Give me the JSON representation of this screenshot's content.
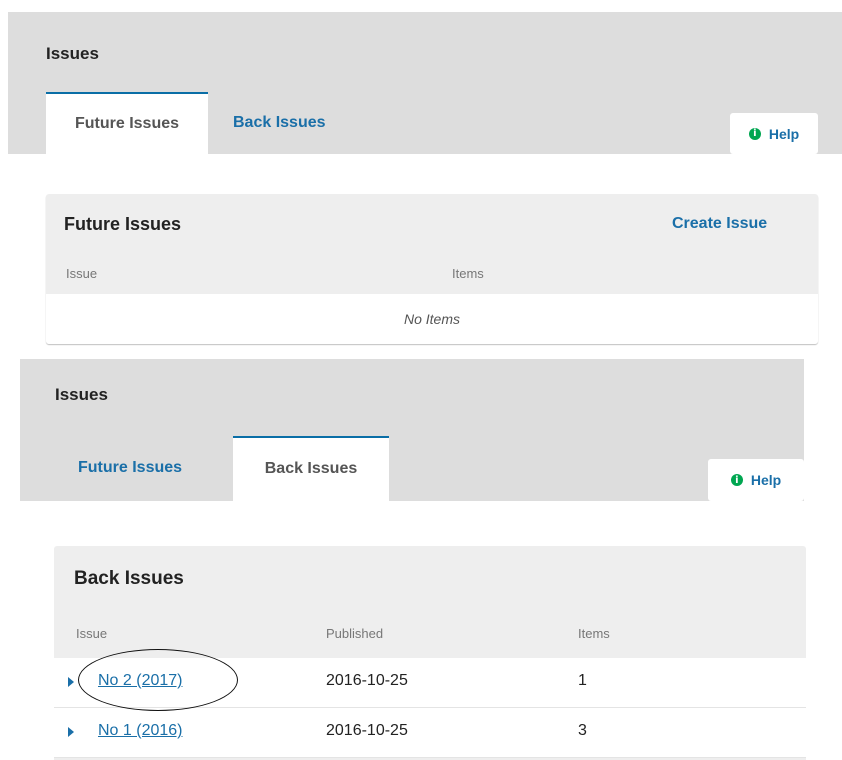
{
  "top_panel": {
    "title": "Issues",
    "tabs": [
      {
        "label": "Future Issues",
        "active": true
      },
      {
        "label": "Back Issues",
        "active": false
      }
    ],
    "help": {
      "icon": "info-circle-icon",
      "label": "Help"
    },
    "grid": {
      "title": "Future Issues",
      "action": "Create Issue",
      "columns": [
        "Issue",
        "Items"
      ],
      "empty_text": "No Items"
    }
  },
  "bottom_panel": {
    "title": "Issues",
    "tabs": [
      {
        "label": "Future Issues",
        "active": false
      },
      {
        "label": "Back Issues",
        "active": true
      }
    ],
    "help": {
      "icon": "info-circle-icon",
      "label": "Help"
    },
    "grid": {
      "title": "Back Issues",
      "columns": [
        "Issue",
        "Published",
        "Items"
      ],
      "rows": [
        {
          "issue": "No 2 (2017)",
          "published": "2016-10-25",
          "items": "1",
          "circled": true
        },
        {
          "issue": "No 1 (2016)",
          "published": "2016-10-25",
          "items": "3",
          "circled": false
        }
      ]
    }
  },
  "colors": {
    "header_bg": "#dddddd",
    "grid_bg": "#eeeeee",
    "link": "#1a6fa8",
    "tab_accent": "#0a6ea6",
    "help_icon": "#00a651"
  }
}
